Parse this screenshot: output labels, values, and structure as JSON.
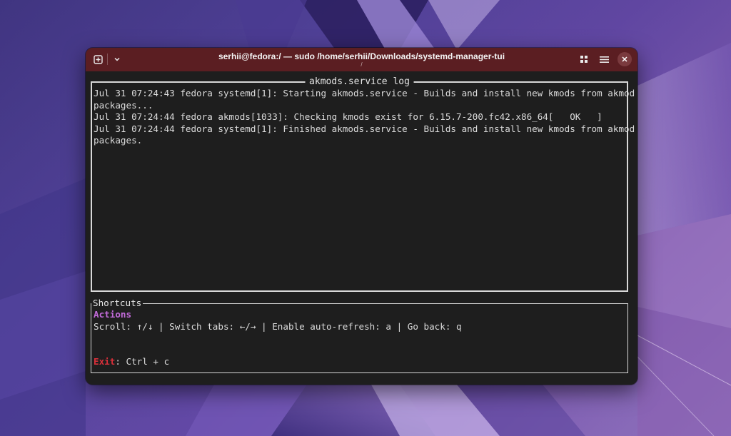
{
  "window": {
    "title": "serhii@fedora:/ — sudo /home/serhii/Downloads/systemd-manager-tui",
    "subtitle": "/"
  },
  "icons": {
    "new_tab": "new-tab-icon",
    "dropdown": "chevron-down-icon",
    "grid": "grid-view-icon",
    "menu": "hamburger-menu-icon",
    "close": "close-icon"
  },
  "log": {
    "title": "akmods.service log",
    "lines": [
      "Jul 31 07:24:43 fedora systemd[1]: Starting akmods.service - Builds and install new kmods from akmod",
      "packages...",
      "Jul 31 07:24:44 fedora akmods[1033]: Checking kmods exist for 6.15.7-200.fc42.x86_64[   OK   ]",
      "Jul 31 07:24:44 fedora systemd[1]: Finished akmods.service - Builds and install new kmods from akmod",
      "packages."
    ]
  },
  "shortcuts": {
    "title": "Shortcuts",
    "actions_label": "Actions",
    "actions_line": "Scroll: ↑/↓ | Switch tabs: ←/→ | Enable auto-refresh: a | Go back: q",
    "exit_label": "Exit",
    "exit_line": ": Ctrl + c"
  },
  "colors": {
    "titlebar": "#5b1e22",
    "terminal_bg": "#1e1e1e",
    "actions": "#c26bd9",
    "exit": "#d9303a"
  }
}
